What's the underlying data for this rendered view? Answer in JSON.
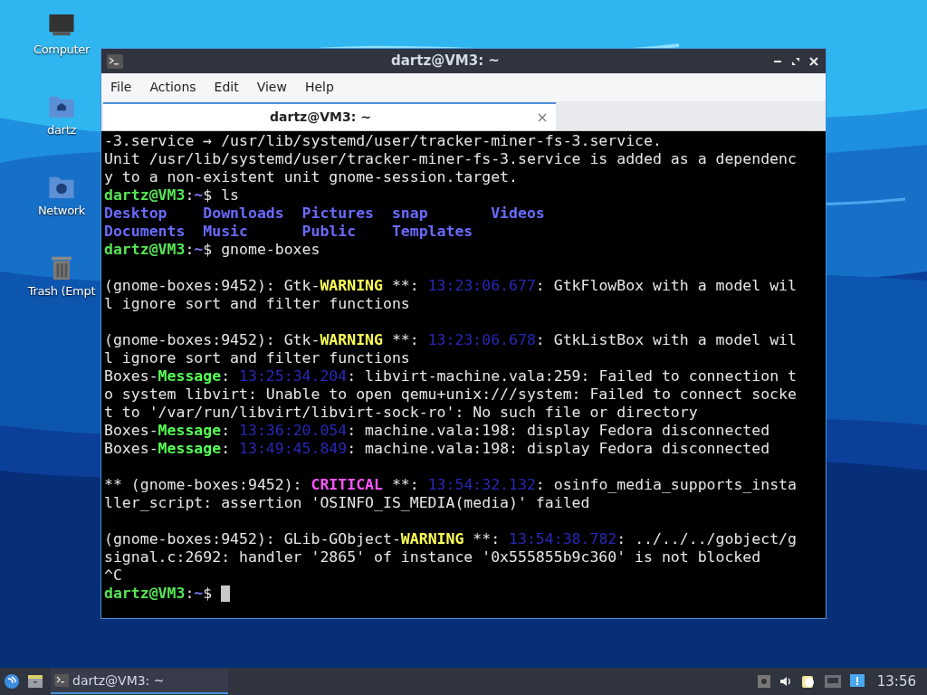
{
  "desktop_icons": [
    {
      "label": "Computer",
      "kind": "computer"
    },
    {
      "label": "dartz",
      "kind": "home"
    },
    {
      "label": "Network",
      "kind": "network"
    },
    {
      "label": "Trash (Empt",
      "kind": "trash"
    }
  ],
  "window": {
    "title": "dartz@VM3: ~"
  },
  "menu": [
    "File",
    "Actions",
    "Edit",
    "View",
    "Help"
  ],
  "tabs": [
    {
      "label": "dartz@VM3: ~",
      "selected": true
    }
  ],
  "terminal": {
    "cursor": true,
    "lines": [
      {
        "kind": "text",
        "segments": [
          {
            "text": "-3.service → /usr/lib/systemd/user/tracker-miner-fs-3.service.",
            "kind": "normal"
          }
        ]
      },
      {
        "kind": "text",
        "segments": [
          {
            "text": "Unit /usr/lib/systemd/user/tracker-miner-fs-3.service is added as a dependenc",
            "kind": "normal"
          }
        ]
      },
      {
        "kind": "text",
        "segments": [
          {
            "text": "y to a non-existent unit gnome-session.target.",
            "kind": "normal"
          }
        ]
      },
      {
        "kind": "text",
        "segments": [
          {
            "text": "dartz@VM3",
            "kind": "user"
          },
          {
            "text": ":",
            "kind": "normal"
          },
          {
            "text": "~",
            "kind": "path"
          },
          {
            "text": "$ ls",
            "kind": "normal"
          }
        ]
      },
      {
        "kind": "text",
        "segments": [
          {
            "text": "Desktop    Downloads  Pictures  snap       Videos",
            "kind": "dir"
          }
        ]
      },
      {
        "kind": "text",
        "segments": [
          {
            "text": "Documents  Music      Public    Templates",
            "kind": "dir"
          }
        ]
      },
      {
        "kind": "text",
        "segments": [
          {
            "text": "dartz@VM3",
            "kind": "user"
          },
          {
            "text": ":",
            "kind": "normal"
          },
          {
            "text": "~",
            "kind": "path"
          },
          {
            "text": "$ gnome-boxes",
            "kind": "normal"
          }
        ]
      },
      {
        "kind": "blank"
      },
      {
        "kind": "text",
        "segments": [
          {
            "text": "(gnome-boxes:9452): Gtk-",
            "kind": "normal"
          },
          {
            "text": "WARNING",
            "kind": "warning"
          },
          {
            "text": " **: ",
            "kind": "normal"
          },
          {
            "text": "13:23:06.677",
            "kind": "time"
          },
          {
            "text": ": GtkFlowBox with a model wil",
            "kind": "normal"
          }
        ]
      },
      {
        "kind": "text",
        "segments": [
          {
            "text": "l ignore sort and filter functions",
            "kind": "normal"
          }
        ]
      },
      {
        "kind": "blank"
      },
      {
        "kind": "text",
        "segments": [
          {
            "text": "(gnome-boxes:9452): Gtk-",
            "kind": "normal"
          },
          {
            "text": "WARNING",
            "kind": "warning"
          },
          {
            "text": " **: ",
            "kind": "normal"
          },
          {
            "text": "13:23:06.678",
            "kind": "time"
          },
          {
            "text": ": GtkListBox with a model wil",
            "kind": "normal"
          }
        ]
      },
      {
        "kind": "text",
        "segments": [
          {
            "text": "l ignore sort and filter functions",
            "kind": "normal"
          }
        ]
      },
      {
        "kind": "text",
        "segments": [
          {
            "text": "Boxes-",
            "kind": "normal"
          },
          {
            "text": "Message",
            "kind": "message"
          },
          {
            "text": ": ",
            "kind": "normal"
          },
          {
            "text": "13:25:34.204",
            "kind": "time"
          },
          {
            "text": ": libvirt-machine.vala:259: Failed to connection t",
            "kind": "normal"
          }
        ]
      },
      {
        "kind": "text",
        "segments": [
          {
            "text": "o system libvirt: Unable to open qemu+unix:///system: Failed to connect socke",
            "kind": "normal"
          }
        ]
      },
      {
        "kind": "text",
        "segments": [
          {
            "text": "t to '/var/run/libvirt/libvirt-sock-ro': No such file or directory",
            "kind": "normal"
          }
        ]
      },
      {
        "kind": "text",
        "segments": [
          {
            "text": "Boxes-",
            "kind": "normal"
          },
          {
            "text": "Message",
            "kind": "message"
          },
          {
            "text": ": ",
            "kind": "normal"
          },
          {
            "text": "13:36:20.054",
            "kind": "time"
          },
          {
            "text": ": machine.vala:198: display Fedora disconnected",
            "kind": "normal"
          }
        ]
      },
      {
        "kind": "text",
        "segments": [
          {
            "text": "Boxes-",
            "kind": "normal"
          },
          {
            "text": "Message",
            "kind": "message"
          },
          {
            "text": ": ",
            "kind": "normal"
          },
          {
            "text": "13:49:45.849",
            "kind": "time"
          },
          {
            "text": ": machine.vala:198: display Fedora disconnected",
            "kind": "normal"
          }
        ]
      },
      {
        "kind": "blank"
      },
      {
        "kind": "text",
        "segments": [
          {
            "text": "** (gnome-boxes:9452): ",
            "kind": "normal"
          },
          {
            "text": "CRITICAL",
            "kind": "critical"
          },
          {
            "text": " **: ",
            "kind": "normal"
          },
          {
            "text": "13:54:32.132",
            "kind": "time"
          },
          {
            "text": ": osinfo_media_supports_insta",
            "kind": "normal"
          }
        ]
      },
      {
        "kind": "text",
        "segments": [
          {
            "text": "ller_script: assertion 'OSINFO_IS_MEDIA(media)' failed",
            "kind": "normal"
          }
        ]
      },
      {
        "kind": "blank"
      },
      {
        "kind": "text",
        "segments": [
          {
            "text": "(gnome-boxes:9452): GLib-GObject-",
            "kind": "normal"
          },
          {
            "text": "WARNING",
            "kind": "warning"
          },
          {
            "text": " **: ",
            "kind": "normal"
          },
          {
            "text": "13:54:38.782",
            "kind": "time"
          },
          {
            "text": ": ../../../gobject/g",
            "kind": "normal"
          }
        ]
      },
      {
        "kind": "text",
        "segments": [
          {
            "text": "signal.c:2692: handler '2865' of instance '0x555855b9c360' is not blocked",
            "kind": "normal"
          }
        ]
      },
      {
        "kind": "text",
        "segments": [
          {
            "text": "^C",
            "kind": "normal"
          }
        ]
      },
      {
        "kind": "text",
        "segments": [
          {
            "text": "dartz@VM3",
            "kind": "user"
          },
          {
            "text": ":",
            "kind": "normal"
          },
          {
            "text": "~",
            "kind": "path"
          },
          {
            "text": "$ ",
            "kind": "normal"
          }
        ]
      }
    ]
  },
  "taskbar": {
    "tasks": [
      {
        "label": "dartz@VM3: ~",
        "selected": true
      }
    ],
    "clock": "13:56"
  }
}
